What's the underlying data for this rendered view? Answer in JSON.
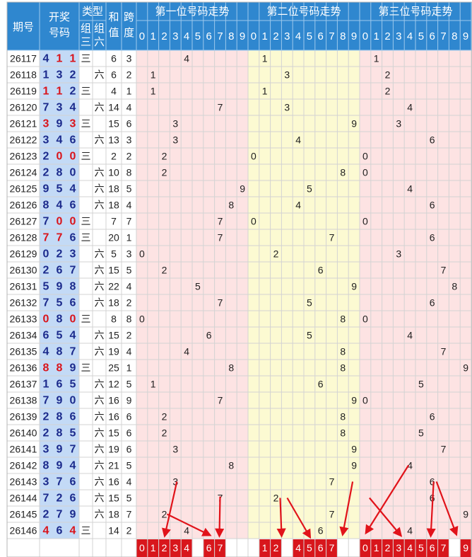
{
  "header": {
    "period": "期号",
    "draw_line1": "开奖",
    "draw_line2": "号码",
    "type": "类型",
    "z3_line1": "组",
    "z3_line2": "三",
    "z6_line1": "组",
    "z6_line2": "六",
    "sum_line1": "和",
    "sum_line2": "值",
    "span_line1": "跨",
    "span_line2": "度",
    "pos1_title": "第一位号码走势",
    "pos2_title": "第二位号码走势",
    "pos3_title": "第三位号码走势",
    "digits": [
      "0",
      "1",
      "2",
      "3",
      "4",
      "5",
      "6",
      "7",
      "8",
      "9"
    ]
  },
  "labels": {
    "z3": "三",
    "z6": "六"
  },
  "colors": {
    "header_bg": "#2f87cf",
    "header_line": "#9cc8ec",
    "pos1_bg": "#fde3e3",
    "pos2_bg": "#fcfad2",
    "pos3_bg": "#fde3e3",
    "draw_bg": "#c3daf6",
    "repeat_digit": "#d9141b",
    "normal_digit": "#1b2a8c",
    "prediction_box": "#d8161c",
    "arrow": "#e1131a"
  },
  "chart_data": {
    "type": "table",
    "rows": [
      {
        "period": "26117",
        "draw": [
          4,
          1,
          1
        ],
        "type": "z3",
        "sum": 6,
        "span": 3
      },
      {
        "period": "26118",
        "draw": [
          1,
          3,
          2
        ],
        "type": "z6",
        "sum": 6,
        "span": 2
      },
      {
        "period": "26119",
        "draw": [
          1,
          1,
          2
        ],
        "type": "z3",
        "sum": 4,
        "span": 1
      },
      {
        "period": "26120",
        "draw": [
          7,
          3,
          4
        ],
        "type": "z6",
        "sum": 14,
        "span": 4
      },
      {
        "period": "26121",
        "draw": [
          3,
          9,
          3
        ],
        "type": "z3",
        "sum": 15,
        "span": 6
      },
      {
        "period": "26122",
        "draw": [
          3,
          4,
          6
        ],
        "type": "z6",
        "sum": 13,
        "span": 3
      },
      {
        "period": "26123",
        "draw": [
          2,
          0,
          0
        ],
        "type": "z3",
        "sum": 2,
        "span": 2
      },
      {
        "period": "26124",
        "draw": [
          2,
          8,
          0
        ],
        "type": "z6",
        "sum": 10,
        "span": 8
      },
      {
        "period": "26125",
        "draw": [
          9,
          5,
          4
        ],
        "type": "z6",
        "sum": 18,
        "span": 5
      },
      {
        "period": "26126",
        "draw": [
          8,
          4,
          6
        ],
        "type": "z6",
        "sum": 18,
        "span": 4
      },
      {
        "period": "26127",
        "draw": [
          7,
          0,
          0
        ],
        "type": "z3",
        "sum": 7,
        "span": 7
      },
      {
        "period": "26128",
        "draw": [
          7,
          7,
          6
        ],
        "type": "z3",
        "sum": 20,
        "span": 1
      },
      {
        "period": "26129",
        "draw": [
          0,
          2,
          3
        ],
        "type": "z6",
        "sum": 5,
        "span": 3
      },
      {
        "period": "26130",
        "draw": [
          2,
          6,
          7
        ],
        "type": "z6",
        "sum": 15,
        "span": 5
      },
      {
        "period": "26131",
        "draw": [
          5,
          9,
          8
        ],
        "type": "z6",
        "sum": 22,
        "span": 4
      },
      {
        "period": "26132",
        "draw": [
          7,
          5,
          6
        ],
        "type": "z6",
        "sum": 18,
        "span": 2
      },
      {
        "period": "26133",
        "draw": [
          0,
          8,
          0
        ],
        "type": "z3",
        "sum": 8,
        "span": 8
      },
      {
        "period": "26134",
        "draw": [
          6,
          5,
          4
        ],
        "type": "z6",
        "sum": 15,
        "span": 2
      },
      {
        "period": "26135",
        "draw": [
          4,
          8,
          7
        ],
        "type": "z6",
        "sum": 19,
        "span": 4
      },
      {
        "period": "26136",
        "draw": [
          8,
          8,
          9
        ],
        "type": "z3",
        "sum": 25,
        "span": 1
      },
      {
        "period": "26137",
        "draw": [
          1,
          6,
          5
        ],
        "type": "z6",
        "sum": 12,
        "span": 5
      },
      {
        "period": "26138",
        "draw": [
          7,
          9,
          0
        ],
        "type": "z6",
        "sum": 16,
        "span": 9
      },
      {
        "period": "26139",
        "draw": [
          2,
          8,
          6
        ],
        "type": "z6",
        "sum": 16,
        "span": 6
      },
      {
        "period": "26140",
        "draw": [
          2,
          8,
          5
        ],
        "type": "z6",
        "sum": 15,
        "span": 6
      },
      {
        "period": "26141",
        "draw": [
          3,
          9,
          7
        ],
        "type": "z6",
        "sum": 19,
        "span": 6
      },
      {
        "period": "26142",
        "draw": [
          8,
          9,
          4
        ],
        "type": "z6",
        "sum": 21,
        "span": 5
      },
      {
        "period": "26143",
        "draw": [
          3,
          7,
          6
        ],
        "type": "z6",
        "sum": 16,
        "span": 4
      },
      {
        "period": "26144",
        "draw": [
          7,
          2,
          6
        ],
        "type": "z6",
        "sum": 15,
        "span": 5
      },
      {
        "period": "26145",
        "draw": [
          2,
          7,
          9
        ],
        "type": "z6",
        "sum": 18,
        "span": 7
      },
      {
        "period": "26146",
        "draw": [
          4,
          6,
          4
        ],
        "type": "z3",
        "sum": 14,
        "span": 2
      }
    ],
    "predictions": {
      "pos1": [
        0,
        1,
        2,
        3,
        4,
        6,
        7
      ],
      "pos2": [
        1,
        2,
        4,
        5,
        6,
        7
      ],
      "pos3": [
        0,
        1,
        2,
        3,
        4,
        5,
        6,
        7,
        9
      ]
    }
  }
}
